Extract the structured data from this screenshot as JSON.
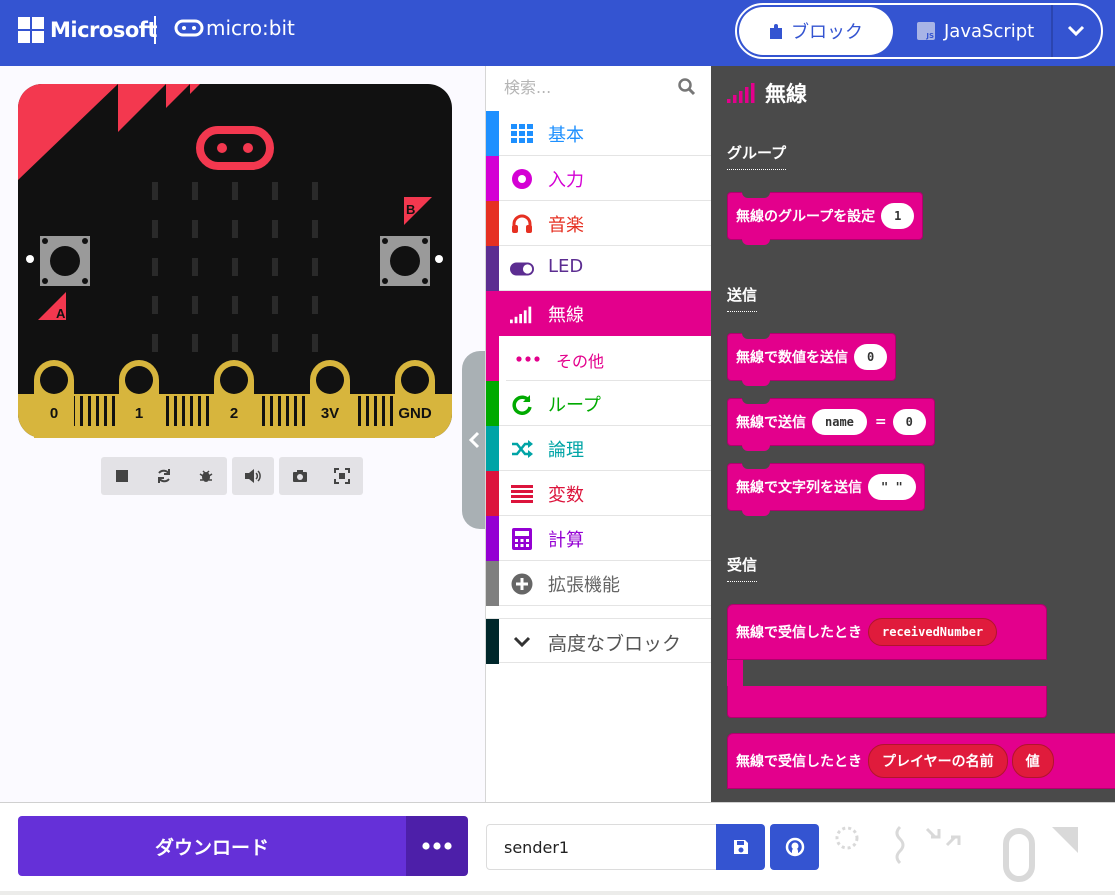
{
  "header": {
    "brand": "Microsoft",
    "product": "micro:bit",
    "tabs": [
      {
        "label": "ブロック",
        "active": true
      },
      {
        "label": "JavaScript",
        "active": false
      }
    ]
  },
  "simulator": {
    "pins": [
      "0",
      "1",
      "2",
      "3V",
      "GND"
    ],
    "buttons": [
      "A",
      "B"
    ],
    "toolbar": [
      "stop-icon",
      "restart-icon",
      "debug-icon",
      "sound-icon",
      "screenshot-icon",
      "fullscreen-icon"
    ]
  },
  "toolbox": {
    "search_placeholder": "検索...",
    "categories": [
      {
        "label": "基本",
        "color": "#1e90ff"
      },
      {
        "label": "入力",
        "color": "#d400d4"
      },
      {
        "label": "音楽",
        "color": "#e63022"
      },
      {
        "label": "LED",
        "color": "#5c2d91"
      },
      {
        "label": "無線",
        "color": "#e3008c",
        "selected": true
      },
      {
        "label": "その他",
        "color": "#e3008c",
        "sub": true
      },
      {
        "label": "ループ",
        "color": "#00aa00"
      },
      {
        "label": "論理",
        "color": "#00a4a6"
      },
      {
        "label": "変数",
        "color": "#dc143c"
      },
      {
        "label": "計算",
        "color": "#9400d3"
      },
      {
        "label": "拡張機能",
        "color": "#7f7f7f"
      },
      {
        "label": "高度なブロック",
        "color": "#00272b"
      }
    ]
  },
  "flyout": {
    "title": "無線",
    "sections": {
      "group": "グループ",
      "send": "送信",
      "receive": "受信"
    },
    "blocks": {
      "set_group": {
        "text": "無線のグループを設定",
        "value": "1"
      },
      "send_number": {
        "text": "無線で数値を送信",
        "value": "0"
      },
      "send_value": {
        "text": "無線で送信",
        "name": "name",
        "eq": "=",
        "value": "0"
      },
      "send_string": {
        "text": "無線で文字列を送信",
        "value": "\" \""
      },
      "on_received_number": {
        "text": "無線で受信したとき",
        "param": "receivedNumber"
      },
      "on_received_value": {
        "text": "無線で受信したとき",
        "param1": "プレイヤーの名前",
        "param2": "値"
      }
    }
  },
  "footer": {
    "download_label": "ダウンロード",
    "project_name": "sender1"
  },
  "colors": {
    "header": "#3454d1",
    "radio": "#e3008c",
    "download": "#6530d8",
    "flyout_bg": "#4a4a4a"
  }
}
